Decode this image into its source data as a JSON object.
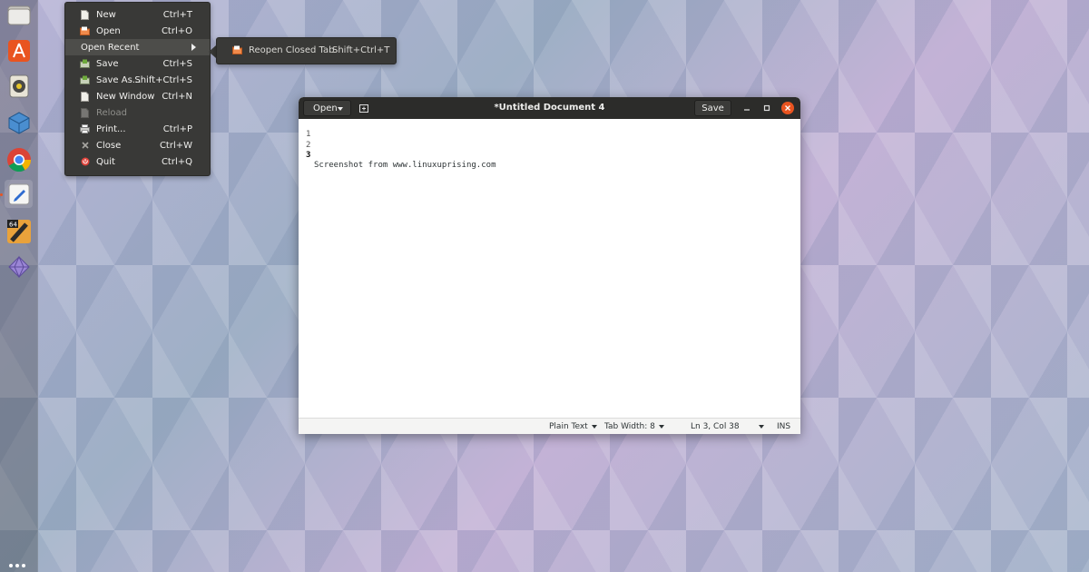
{
  "dock": {
    "items": [
      {
        "name": "files-icon"
      },
      {
        "name": "ubuntu-software-icon"
      },
      {
        "name": "rhythmbox-icon"
      },
      {
        "name": "virtualbox-icon"
      },
      {
        "name": "chrome-icon"
      },
      {
        "name": "text-editor-icon"
      },
      {
        "name": "eclipse-64-icon",
        "badge": "64"
      },
      {
        "name": "crystal-icon"
      }
    ]
  },
  "menu": {
    "items": [
      {
        "label": "New",
        "accel": "Ctrl+T",
        "icon": "new-document-icon"
      },
      {
        "label": "Open",
        "accel": "Ctrl+O",
        "icon": "open-folder-icon"
      },
      {
        "label": "Open Recent",
        "accel": "",
        "icon": ""
      },
      {
        "label": "Save",
        "accel": "Ctrl+S",
        "icon": "save-icon"
      },
      {
        "label": "Save As...",
        "accel": "Shift+Ctrl+S",
        "icon": "save-as-icon"
      },
      {
        "label": "New Window",
        "accel": "Ctrl+N",
        "icon": "new-window-icon"
      },
      {
        "label": "Reload",
        "accel": "",
        "icon": "reload-icon"
      },
      {
        "label": "Print...",
        "accel": "Ctrl+P",
        "icon": "print-icon"
      },
      {
        "label": "Close",
        "accel": "Ctrl+W",
        "icon": "close-icon"
      },
      {
        "label": "Quit",
        "accel": "Ctrl+Q",
        "icon": "quit-icon"
      }
    ],
    "submenu": {
      "label": "Reopen Closed Tab",
      "accel": "Shift+Ctrl+T"
    }
  },
  "window": {
    "title": "*Untitled Document 4",
    "open_label": "Open",
    "save_label": "Save",
    "lines": [
      {
        "num": "1",
        "text": ""
      },
      {
        "num": "2",
        "text": ""
      },
      {
        "num": "3",
        "text": "Screenshot from www.linuxuprising.com"
      }
    ],
    "status": {
      "language": "Plain Text",
      "tab_width": "Tab Width: 8",
      "position": "Ln 3, Col 38",
      "mode": "INS"
    }
  },
  "colors": {
    "accent": "#e95420",
    "menu_bg": "#393937",
    "headerbar": "#2c2c2a"
  }
}
